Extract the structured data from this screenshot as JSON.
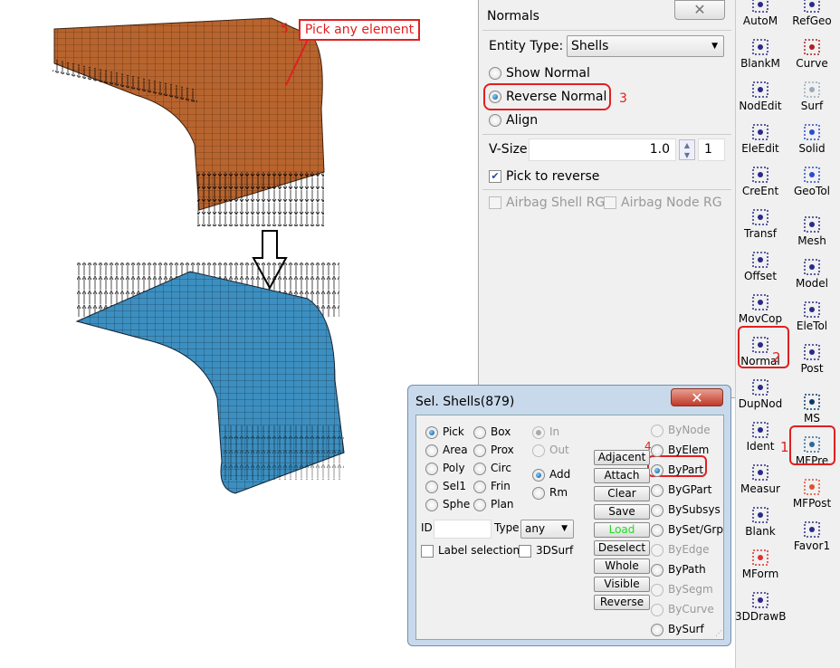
{
  "annotations": {
    "step5": "5",
    "pick_label": "Pick any element",
    "step3": "3",
    "step2": "2",
    "step1": "1",
    "step4": "4"
  },
  "normals": {
    "title": "Normals",
    "close": "✕",
    "entity_label": "Entity Type:",
    "entity_value": "Shells",
    "options": [
      {
        "label": "Show Normal",
        "selected": false
      },
      {
        "label": "Reverse Normal",
        "selected": true
      },
      {
        "label": "Align",
        "selected": false
      }
    ],
    "vsize_label": "V-Size",
    "vsize_value": "1.0",
    "vsize_step": "1",
    "pick_reverse": "Pick to reverse",
    "airbag_shell": "Airbag Shell RG",
    "airbag_node": "Airbag Node RG"
  },
  "sel": {
    "title": "Sel. Shells(879)",
    "close": "✕",
    "col1": [
      "Pick",
      "Area",
      "Poly",
      "Sel1",
      "Sphe"
    ],
    "col2": [
      "Box",
      "Prox",
      "Circ",
      "Frin",
      "Plan"
    ],
    "in": "In",
    "out": "Out",
    "add": "Add",
    "rm": "Rm",
    "id_label": "ID",
    "id_value": "",
    "type_label": "Type",
    "type_value": "any",
    "label_selection": "Label selection",
    "surf3d": "3DSurf",
    "buttons": [
      "Adjacent",
      "Attach",
      "Clear",
      "Save",
      "Load",
      "Deselect",
      "Whole",
      "Visible",
      "Reverse"
    ],
    "by": [
      "ByNode",
      "ByElem",
      "ByPart",
      "ByGPart",
      "BySubsys",
      "BySet/Grp",
      "ByEdge",
      "ByPath",
      "BySegm",
      "ByCurve",
      "BySurf"
    ],
    "load_color": "#22dd22"
  },
  "toolbar": {
    "left": [
      "AutoM",
      "BlankM",
      "NodEdit",
      "EleEdit",
      "CreEnt",
      "Transf",
      "Offset",
      "MovCop",
      "Normal",
      "DupNod",
      "Ident",
      "Measur",
      "Blank",
      "MForm",
      "3DDrawB"
    ],
    "right": [
      "RefGeo",
      "Curve",
      "Surf",
      "Solid",
      "GeoTol",
      "Mesh",
      "Model",
      "EleTol",
      "Post",
      "MS",
      "MFPre",
      "MFPost",
      "Favor1"
    ]
  },
  "colors": {
    "annotation": "#e02020",
    "mesh_before": "#b8642e",
    "mesh_after": "#3c8fc0"
  }
}
